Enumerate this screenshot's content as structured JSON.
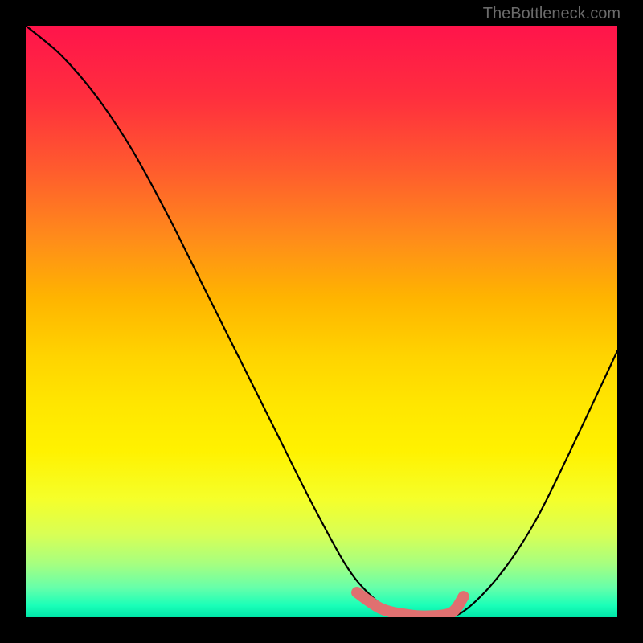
{
  "attribution": "TheBottleneck.com",
  "chart_data": {
    "type": "line",
    "title": "",
    "xlabel": "",
    "ylabel": "",
    "xlim": [
      0,
      100
    ],
    "ylim": [
      0,
      100
    ],
    "series": [
      {
        "name": "bottleneck-curve",
        "x": [
          0,
          6,
          12,
          18,
          24,
          30,
          36,
          42,
          48,
          54,
          58,
          62,
          66,
          70,
          74,
          80,
          86,
          92,
          100
        ],
        "y": [
          100,
          95,
          88,
          79,
          68,
          56,
          44,
          32,
          20,
          9,
          4,
          1,
          0,
          0,
          1,
          7,
          16,
          28,
          45
        ]
      }
    ],
    "highlight_segment": {
      "name": "optimal-range",
      "x": [
        56,
        60,
        64,
        68,
        72,
        74
      ],
      "y": [
        4.2,
        1.5,
        0.5,
        0.2,
        0.8,
        3.5
      ]
    },
    "background_gradient": {
      "top": "#ff144b",
      "mid": "#ffe600",
      "bottom": "#00e6a8"
    }
  }
}
